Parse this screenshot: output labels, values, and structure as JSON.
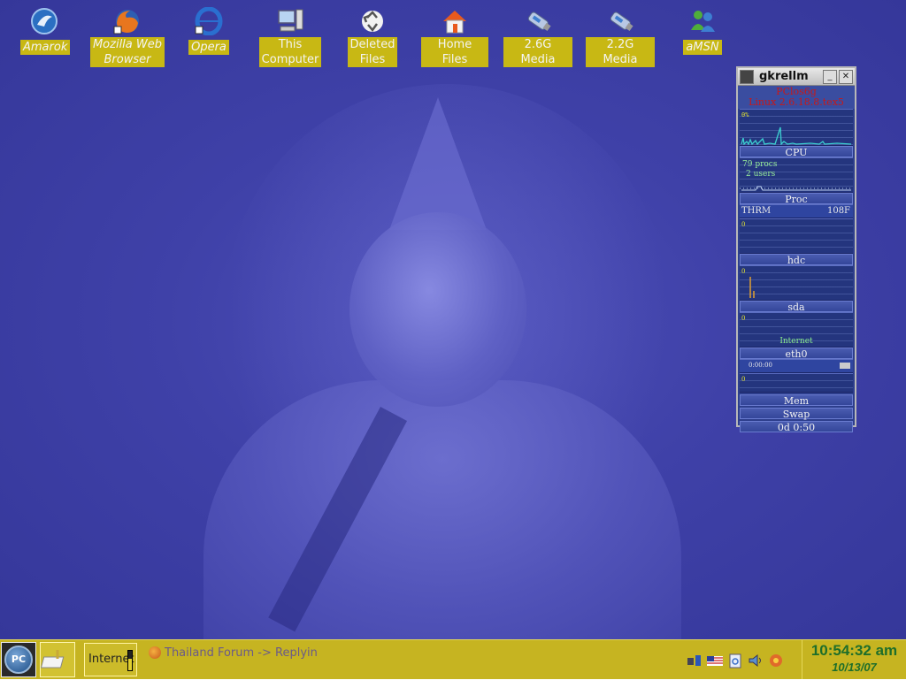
{
  "desktop": {
    "icons": [
      {
        "label": "Amarok",
        "icon": "amarok-icon"
      },
      {
        "label": "Mozilla Web\nBrowser",
        "icon": "firefox-icon"
      },
      {
        "label": "Opera",
        "icon": "opera-icon"
      },
      {
        "label": "This\nComputer",
        "icon": "computer-icon"
      },
      {
        "label": "Deleted\nFiles",
        "icon": "trash-icon"
      },
      {
        "label": "Home Files",
        "icon": "home-icon"
      },
      {
        "label": "2.6G Media",
        "icon": "usb-drive-icon"
      },
      {
        "label": "2.2G Media",
        "icon": "usb-drive-icon"
      },
      {
        "label": "aMSN",
        "icon": "amsn-icon"
      }
    ]
  },
  "gkrellm": {
    "title": "gkrellm",
    "hostname": "PClos6g",
    "kernel": "Linux 2.6.18.8.tex5",
    "cpu_scale": "0%",
    "cpu_label": "CPU",
    "procs_text": "79  procs",
    "users_text": "2  users",
    "proc_label": "Proc",
    "thrm_label": "THRM",
    "thrm_value": "108F",
    "zero": "0",
    "hdc_label": "hdc",
    "sda_label": "sda",
    "net_label": "Internet",
    "eth_label": "eth0",
    "eth_timer": "0:00:00",
    "mem_label": "Mem",
    "swap_label": "Swap",
    "uptime": "0d  0:50"
  },
  "taskbar": {
    "internet_label": "Internet",
    "internet_meter_fraction": 0.6,
    "window_title": "Thailand Forum -> Replyin",
    "tray_icons": [
      "network-icon",
      "flag-keyboard-icon",
      "clipboard-icon",
      "volume-icon",
      "update-icon"
    ],
    "clock_time": "10:54:32 am",
    "clock_date": "10/13/07"
  },
  "colors": {
    "desktop_bg": "#3f41a8",
    "taskbar_bg": "#c6b421",
    "icon_label_bg": "#c8b814",
    "clock_text": "#1e6e2a"
  }
}
